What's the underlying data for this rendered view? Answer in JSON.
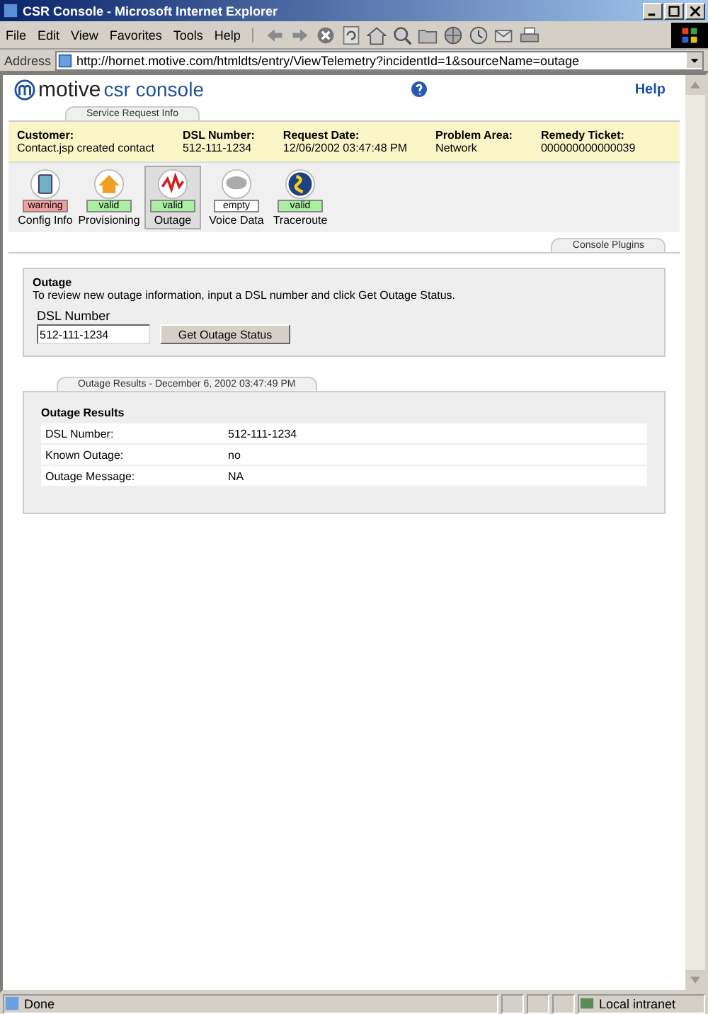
{
  "window": {
    "title": "CSR Console - Microsoft Internet Explorer"
  },
  "menu": [
    "File",
    "Edit",
    "View",
    "Favorites",
    "Tools",
    "Help"
  ],
  "address": {
    "label": "Address",
    "value": "http://hornet.motive.com/htmldts/entry/ViewTelemetry?incidentId=1&sourceName=outage"
  },
  "header": {
    "logo_word": "motive",
    "logo_product": "csr console",
    "help": "Help",
    "tab": "Service Request Info"
  },
  "request_info": [
    {
      "label": "Customer:",
      "value": "Contact.jsp created contact"
    },
    {
      "label": "DSL Number:",
      "value": "512-111-1234"
    },
    {
      "label": "Request Date:",
      "value": "12/06/2002 03:47:48 PM"
    },
    {
      "label": "Problem Area:",
      "value": "Network"
    },
    {
      "label": "Remedy Ticket:",
      "value": "000000000000039"
    }
  ],
  "plugins": [
    {
      "kind": "config",
      "status": "warning",
      "label": "Config Info",
      "selected": false
    },
    {
      "kind": "house",
      "status": "valid",
      "label": "Provisioning",
      "selected": false
    },
    {
      "kind": "outage",
      "status": "valid",
      "label": "Outage",
      "selected": true
    },
    {
      "kind": "voice",
      "status": "empty",
      "label": "Voice Data",
      "selected": false
    },
    {
      "kind": "globe",
      "status": "valid",
      "label": "Traceroute",
      "selected": false
    }
  ],
  "plugins_tab": "Console Plugins",
  "outage_form": {
    "title": "Outage",
    "instructions": "To review new outage information, input a DSL number and click Get Outage Status.",
    "field_label": "DSL Number",
    "field_value": "512-111-1234",
    "button": "Get Outage Status"
  },
  "results": {
    "tab": "Outage Results - December 6, 2002 03:47:49 PM",
    "title": "Outage Results",
    "rows": [
      {
        "label": "DSL Number:",
        "value": "512-111-1234"
      },
      {
        "label": "Known Outage:",
        "value": "no"
      },
      {
        "label": "Outage Message:",
        "value": "NA"
      }
    ]
  },
  "status_bar": {
    "text": "Done",
    "zone": "Local intranet"
  }
}
